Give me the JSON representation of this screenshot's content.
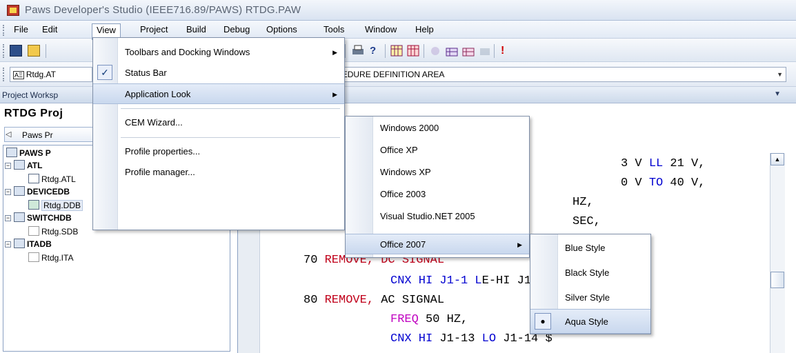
{
  "window": {
    "title": "Paws Developer's Studio (IEEE716.89/PAWS) RTDG.PAW"
  },
  "menubar": {
    "items": [
      "File",
      "Edit",
      "View",
      "Project",
      "Build",
      "Debug",
      "Options",
      "Tools",
      "Window",
      "Help"
    ]
  },
  "combobar": {
    "file_label": "Rtdg.AT",
    "message": "T OUTSIDE OF THE ATLAS PROCEDURE DEFINITION AREA"
  },
  "workspace": {
    "header": "Project Worksp",
    "project_title": "RTDG  Proj",
    "tab_label": "Paws Pr",
    "tree": [
      {
        "label": "PAWS P",
        "bold": true
      },
      {
        "label": "ATL",
        "bold": true
      },
      {
        "label": "Rtdg.ATL",
        "bold": false
      },
      {
        "label": "DEVICEDB",
        "bold": true
      },
      {
        "label": "Rtdg.DDB",
        "bold": false
      },
      {
        "label": "SWITCHDB",
        "bold": true
      },
      {
        "label": "Rtdg.SDB",
        "bold": false
      },
      {
        "label": "ITADB",
        "bold": true
      },
      {
        "label": "Rtdg.ITA",
        "bold": false
      }
    ]
  },
  "editor": {
    "lines": [
      {
        "parts": [
          {
            "t": "3 V ",
            "c": ""
          },
          {
            "t": "LL",
            "c": "kw"
          },
          {
            "t": " 21 V,",
            "c": ""
          }
        ]
      },
      {
        "parts": [
          {
            "t": "0 V ",
            "c": ""
          },
          {
            "t": "TO",
            "c": "kw"
          },
          {
            "t": " 40 V,",
            "c": ""
          }
        ]
      },
      {
        "parts": [
          {
            "t": "HZ,",
            "c": ""
          }
        ]
      },
      {
        "parts": [
          {
            "t": "SEC,",
            "c": ""
          }
        ]
      },
      {
        "parts": [
          {
            "t": "70 ",
            "c": ""
          },
          {
            "t": "REMOVE, DC SIGNAL",
            "c": "red"
          }
        ]
      },
      {
        "parts": [
          {
            "t": "CNX HI J1-1 L",
            "c": "kw"
          },
          {
            "t": "E-HI J1-3",
            "c": ""
          }
        ]
      },
      {
        "parts": [
          {
            "t": "80 ",
            "c": ""
          },
          {
            "t": "REMOVE,",
            "c": "red"
          },
          {
            "t": " AC SIGNAL",
            "c": ""
          }
        ]
      },
      {
        "parts": [
          {
            "t": "FREQ",
            "c": "mag"
          },
          {
            "t": " 50 HZ,",
            "c": ""
          }
        ]
      },
      {
        "parts": [
          {
            "t": "CNX HI",
            "c": "kw"
          },
          {
            "t": " J1-13 ",
            "c": ""
          },
          {
            "t": "LO",
            "c": "kw"
          },
          {
            "t": " J1-14 $",
            "c": ""
          }
        ]
      }
    ]
  },
  "view_menu": {
    "items": [
      {
        "label": "Toolbars and Docking Windows",
        "accel": "T",
        "submenu": true
      },
      {
        "label": "Status Bar",
        "accel": "S",
        "checked": true
      },
      {
        "label": "Application Look",
        "accel": "A",
        "submenu": true,
        "highlighted": true
      },
      {
        "label": "CEM Wizard...",
        "accel": "W"
      },
      {
        "label": "Profile properties...",
        "accel": "p"
      },
      {
        "label": "Profile manager...",
        "accel": "m"
      }
    ]
  },
  "look_menu": {
    "items": [
      {
        "label": "Windows 2000",
        "accel": "2"
      },
      {
        "label": "Office XP",
        "accel": "X"
      },
      {
        "label": "Windows XP",
        "accel": "W"
      },
      {
        "label": "Office 2003",
        "accel": "3"
      },
      {
        "label": "Visual Studio.NET 2005",
        "accel": "5"
      },
      {
        "label": "Office 2007",
        "accel": "7",
        "submenu": true,
        "highlighted": true
      }
    ]
  },
  "office2007_menu": {
    "items": [
      {
        "label": "Blue Style",
        "accel": "B"
      },
      {
        "label": "Black Style",
        "accel": "l"
      },
      {
        "label": "Silver Style",
        "accel": "S"
      },
      {
        "label": "Aqua Style",
        "accel": "A",
        "selected": true,
        "highlighted": true
      }
    ]
  }
}
